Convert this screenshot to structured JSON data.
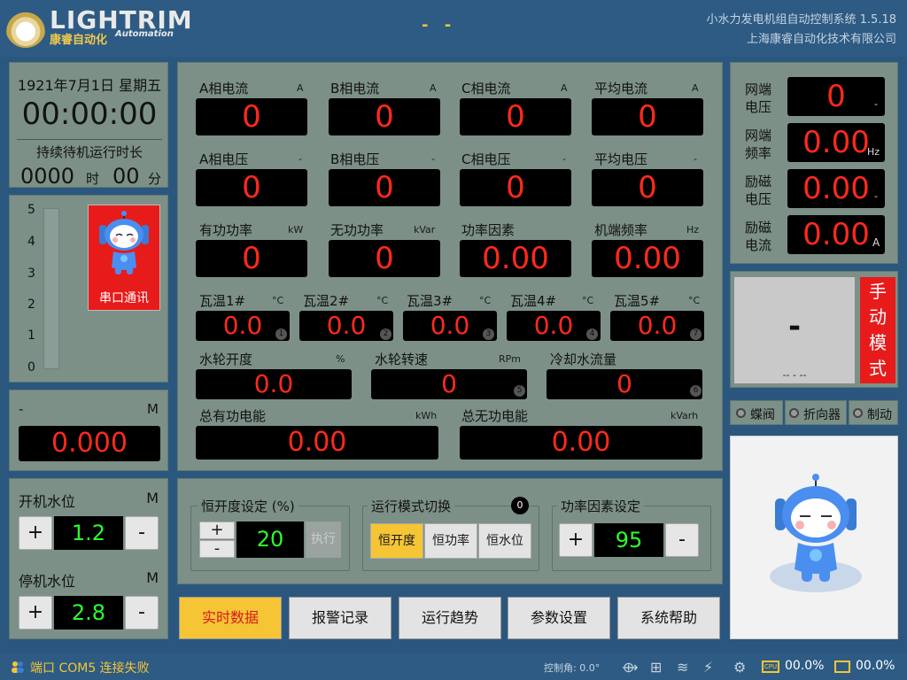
{
  "header": {
    "logo_text": "LIGHTRIM",
    "logo_cn": "康睿自动化",
    "logo_en": "Automation",
    "center_status": "- -",
    "system_title": "小水力发电机组自动控制系统 1.5.18",
    "company": "上海康睿自动化技术有限公司"
  },
  "datetime": {
    "date": "1921年7月1日 星期五",
    "time": "00:00:00",
    "run_label": "持续待机运行时长",
    "hours": "0000",
    "hours_unit": "时",
    "minutes": "00",
    "minutes_unit": "分"
  },
  "gauge": {
    "ticks": [
      "5",
      "4",
      "3",
      "2",
      "1",
      "0"
    ],
    "level": 0,
    "serial_label": "串口通讯"
  },
  "mpanel": {
    "label": "-",
    "unit": "M",
    "value": "0.000"
  },
  "water": {
    "start_label": "开机水位",
    "start_unit": "M",
    "start_value": "1.2",
    "stop_label": "停机水位",
    "stop_unit": "M",
    "stop_value": "2.8",
    "plus": "+",
    "minus": "-"
  },
  "main": {
    "row1": [
      {
        "label": "A相电流",
        "unit": "A",
        "value": "0"
      },
      {
        "label": "B相电流",
        "unit": "A",
        "value": "0"
      },
      {
        "label": "C相电流",
        "unit": "A",
        "value": "0"
      },
      {
        "label": "平均电流",
        "unit": "A",
        "value": "0"
      }
    ],
    "row2": [
      {
        "label": "A相电压",
        "unit": "-",
        "value": "0"
      },
      {
        "label": "B相电压",
        "unit": "-",
        "value": "0"
      },
      {
        "label": "C相电压",
        "unit": "-",
        "value": "0"
      },
      {
        "label": "平均电压",
        "unit": "-",
        "value": "0"
      }
    ],
    "row3": [
      {
        "label": "有功功率",
        "unit": "kW",
        "value": "0"
      },
      {
        "label": "无功功率",
        "unit": "kVar",
        "value": "0"
      },
      {
        "label": "功率因素",
        "unit": "",
        "value": "0.00"
      },
      {
        "label": "机端频率",
        "unit": "Hz",
        "value": "0.00"
      }
    ],
    "temps": [
      {
        "label": "瓦温1#",
        "unit": "°C",
        "value": "0.0",
        "idx": "1"
      },
      {
        "label": "瓦温2#",
        "unit": "°C",
        "value": "0.0",
        "idx": "2"
      },
      {
        "label": "瓦温3#",
        "unit": "°C",
        "value": "0.0",
        "idx": "3"
      },
      {
        "label": "瓦温4#",
        "unit": "°C",
        "value": "0.0",
        "idx": "4"
      },
      {
        "label": "瓦温5#",
        "unit": "°C",
        "value": "0.0",
        "idx": "7"
      }
    ],
    "row5": [
      {
        "label": "水轮开度",
        "unit": "%",
        "value": "0.0",
        "idx": ""
      },
      {
        "label": "水轮转速",
        "unit": "RPm",
        "value": "0",
        "idx": "5"
      },
      {
        "label": "冷却水流量",
        "unit": "",
        "value": "0",
        "idx": "6"
      }
    ],
    "row6": [
      {
        "label": "总有功电能",
        "unit": "kWh",
        "value": "0.00"
      },
      {
        "label": "总无功电能",
        "unit": "kVarh",
        "value": "0.00"
      }
    ]
  },
  "control": {
    "opening_title": "恒开度设定 (%)",
    "opening_value": "20",
    "execute": "执行",
    "mode_title": "运行模式切换",
    "mode_badge": "0",
    "modes": [
      "恒开度",
      "恒功率",
      "恒水位"
    ],
    "pf_title": "功率因素设定",
    "pf_value": "95",
    "plus": "+",
    "minus": "-"
  },
  "nav": [
    "实时数据",
    "报警记录",
    "运行趋势",
    "参数设置",
    "系统帮助"
  ],
  "grid": [
    {
      "label1": "网端",
      "label2": "电压",
      "value": "0",
      "unit": "-"
    },
    {
      "label1": "网端",
      "label2": "频率",
      "value": "0.00",
      "unit": "Hz"
    },
    {
      "label1": "励磁",
      "label2": "电压",
      "value": "0.00",
      "unit": "-"
    },
    {
      "label1": "励磁",
      "label2": "电流",
      "value": "0.00",
      "unit": "A"
    }
  ],
  "mode": {
    "value": "-",
    "sub": "-- - --",
    "label": "手动模式",
    "chars": [
      "手",
      "动",
      "模",
      "式"
    ]
  },
  "status": {
    "items": [
      "蝶阀",
      "折向器",
      "制动"
    ]
  },
  "footer": {
    "port_status": "端口 COM5 连接失败",
    "angle": "控制角: 0.0°",
    "cpu": "00.0%",
    "mem": "00.0%"
  },
  "colors": {
    "accent": "#f6c536",
    "display_red": "#ff2a1a",
    "display_green": "#2bff2b",
    "panel": "#7c9087",
    "bg": "#2b577f",
    "serial": "#e81b1b"
  }
}
